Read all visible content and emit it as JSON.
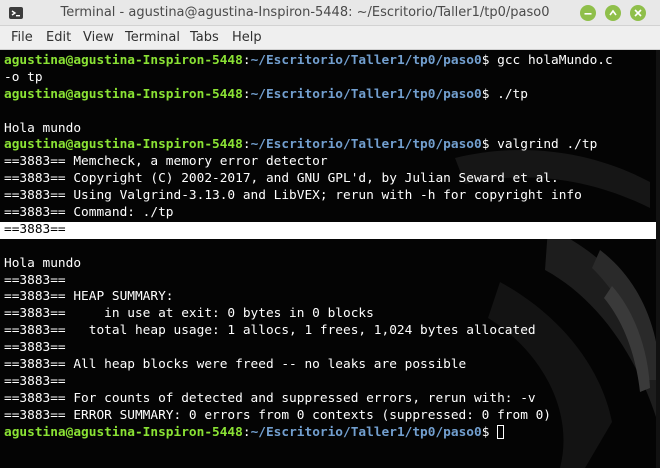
{
  "window": {
    "title": "Terminal - agustina@agustina-Inspiron-5448: ~/Escritorio/Taller1/tp0/paso0",
    "accent": "#8fbf4a"
  },
  "menu": [
    {
      "label": "File"
    },
    {
      "label": "Edit"
    },
    {
      "label": "View"
    },
    {
      "label": "Terminal"
    },
    {
      "label": "Tabs"
    },
    {
      "label": "Help"
    }
  ],
  "prompt": {
    "user": "agustina@agustina-Inspiron-5448",
    "sep": ":",
    "path": "~/Escritorio/Taller1/tp0/paso0",
    "sign": "$ "
  },
  "terminal": {
    "colors": {
      "user": "#8ae234",
      "path": "#729fcf",
      "text": "#ffffff",
      "background": "#000000"
    },
    "lines": [
      {
        "type": "prompt",
        "cmd": "gcc holaMundo.c"
      },
      {
        "type": "text",
        "text": "-o tp"
      },
      {
        "type": "prompt",
        "cmd": "./tp"
      },
      {
        "type": "text",
        "text": ""
      },
      {
        "type": "text",
        "text": "Hola mundo"
      },
      {
        "type": "prompt",
        "cmd": "valgrind ./tp"
      },
      {
        "type": "text",
        "text": "==3883== Memcheck, a memory error detector"
      },
      {
        "type": "text",
        "text": "==3883== Copyright (C) 2002-2017, and GNU GPL'd, by Julian Seward et al."
      },
      {
        "type": "text",
        "text": "==3883== Using Valgrind-3.13.0 and LibVEX; rerun with -h for copyright info"
      },
      {
        "type": "text",
        "text": "==3883== Command: ./tp"
      },
      {
        "type": "highlight",
        "text": "==3883=="
      },
      {
        "type": "text",
        "text": ""
      },
      {
        "type": "text",
        "text": "Hola mundo"
      },
      {
        "type": "text",
        "text": "==3883=="
      },
      {
        "type": "text",
        "text": "==3883== HEAP SUMMARY:"
      },
      {
        "type": "text",
        "text": "==3883==     in use at exit: 0 bytes in 0 blocks"
      },
      {
        "type": "text",
        "text": "==3883==   total heap usage: 1 allocs, 1 frees, 1,024 bytes allocated"
      },
      {
        "type": "text",
        "text": "==3883=="
      },
      {
        "type": "text",
        "text": "==3883== All heap blocks were freed -- no leaks are possible"
      },
      {
        "type": "text",
        "text": "==3883=="
      },
      {
        "type": "text",
        "text": "==3883== For counts of detected and suppressed errors, rerun with: -v"
      },
      {
        "type": "text",
        "text": "==3883== ERROR SUMMARY: 0 errors from 0 contexts (suppressed: 0 from 0)"
      },
      {
        "type": "prompt",
        "cmd": "",
        "cursor": true
      }
    ]
  }
}
